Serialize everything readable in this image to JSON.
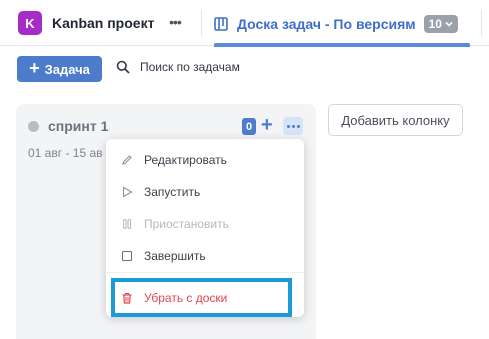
{
  "header": {
    "project_initial": "K",
    "project_name": "Kanban проект",
    "project_more": "•••",
    "board_title": "Доска задач - По версиям",
    "board_count": "10"
  },
  "toolbar": {
    "add_task_label": "Задача",
    "add_task_plus": "+",
    "search_label": "Поиск по задачам"
  },
  "column": {
    "title": "спринт 1",
    "dates": "01 авг - 15 ав",
    "count": "0",
    "plus": "+"
  },
  "add_column_label": "Добавить колонку",
  "menu": {
    "items": [
      {
        "label": "Редактировать",
        "icon": "pencil-icon",
        "disabled": false
      },
      {
        "label": "Запустить",
        "icon": "play-icon",
        "disabled": false
      },
      {
        "label": "Приостановить",
        "icon": "pause-icon",
        "disabled": true
      },
      {
        "label": "Завершить",
        "icon": "stop-icon",
        "disabled": false
      }
    ],
    "danger_item": {
      "label": "Убрать с доски",
      "icon": "trash-icon"
    }
  },
  "colors": {
    "accent": "#4d7ccc",
    "project_avatar": "#a52cc6",
    "danger": "#e0484e",
    "highlight": "#1a9ad6"
  }
}
